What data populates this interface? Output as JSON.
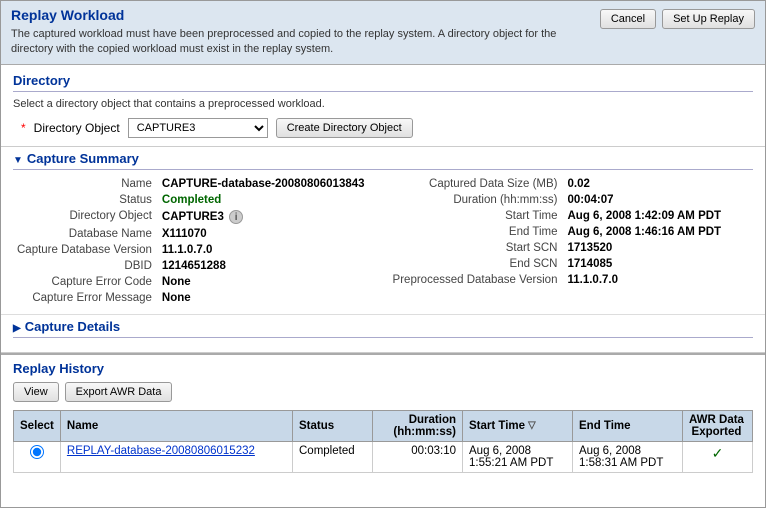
{
  "page": {
    "title": "Replay Workload",
    "description": "The captured workload must have been preprocessed and copied to the replay system. A directory object for the directory with the copied workload must exist in the replay system."
  },
  "header": {
    "cancel_label": "Cancel",
    "setup_label": "Set Up Replay"
  },
  "directory": {
    "title": "Directory",
    "description": "Select a directory object that contains a preprocessed workload.",
    "required_star": "*",
    "object_label": "Directory Object",
    "object_value": "CAPTURE3",
    "create_button_label": "Create Directory Object"
  },
  "capture_summary": {
    "title": "Capture Summary",
    "left": {
      "name_label": "Name",
      "name_value": "CAPTURE-database-20080806013843",
      "status_label": "Status",
      "status_value": "Completed",
      "dir_object_label": "Directory Object",
      "dir_object_value": "CAPTURE3",
      "db_name_label": "Database Name",
      "db_name_value": "X111070",
      "db_version_label": "Capture Database Version",
      "db_version_value": "11.1.0.7.0",
      "dbid_label": "DBID",
      "dbid_value": "1214651288",
      "error_code_label": "Capture Error Code",
      "error_code_value": "None",
      "error_msg_label": "Capture Error Message",
      "error_msg_value": "None"
    },
    "right": {
      "data_size_label": "Captured Data Size (MB)",
      "data_size_value": "0.02",
      "duration_label": "Duration (hh:mm:ss)",
      "duration_value": "00:04:07",
      "start_time_label": "Start Time",
      "start_time_value": "Aug 6, 2008 1:42:09 AM PDT",
      "end_time_label": "End Time",
      "end_time_value": "Aug 6, 2008 1:46:16 AM PDT",
      "start_scn_label": "Start SCN",
      "start_scn_value": "1713520",
      "end_scn_label": "End SCN",
      "end_scn_value": "1714085",
      "pre_db_ver_label": "Preprocessed Database Version",
      "pre_db_ver_value": "11.1.0.7.0"
    }
  },
  "capture_details": {
    "title": "Capture Details"
  },
  "replay_history": {
    "title": "Replay History",
    "view_label": "View",
    "export_label": "Export AWR Data",
    "table": {
      "headers": [
        "Select",
        "Name",
        "Status",
        "Duration\n(hh:mm:ss)",
        "Start Time",
        "End Time",
        "AWR Data\nExported"
      ],
      "rows": [
        {
          "select": "radio",
          "name": "REPLAY-database-20080806015232",
          "status": "Completed",
          "duration": "00:03:10",
          "start_time": "Aug 6, 2008 1:55:21 AM PDT",
          "end_time": "Aug 6, 2008 1:58:31 AM PDT",
          "awr_exported": "check"
        }
      ]
    }
  }
}
